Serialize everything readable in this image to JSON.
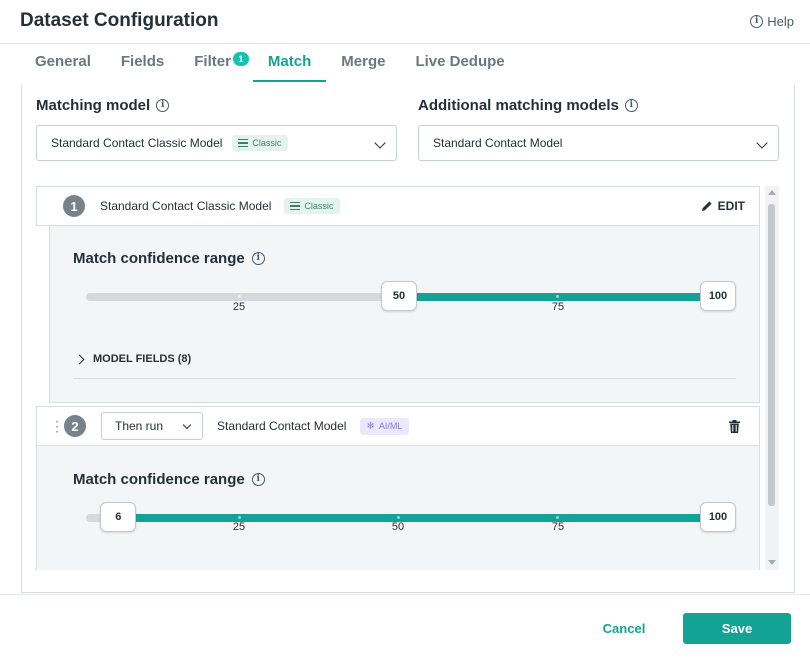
{
  "dialog": {
    "title": "Dataset Configuration",
    "help_label": "Help"
  },
  "tabs": [
    {
      "label": "General"
    },
    {
      "label": "Fields"
    },
    {
      "label": "Filter",
      "badge": "1"
    },
    {
      "label": "Match",
      "active": true
    },
    {
      "label": "Merge"
    },
    {
      "label": "Live Dedupe"
    }
  ],
  "matching_model": {
    "label": "Matching model",
    "value": "Standard Contact Classic Model",
    "badge": "Classic"
  },
  "additional_models": {
    "label": "Additional matching models",
    "value": "Standard Contact Model"
  },
  "cards": [
    {
      "step": "1",
      "model_name": "Standard Contact Classic Model",
      "badge": "Classic",
      "edit_label": "EDIT",
      "confidence_label": "Match confidence range",
      "range_min": 50,
      "range_max": 100,
      "ticks": [
        "25",
        "75"
      ],
      "model_fields_label": "MODEL FIELDS (8)"
    },
    {
      "step": "2",
      "then_run_label": "Then run",
      "model_name": "Standard Contact Model",
      "badge": "AI/ML",
      "confidence_label": "Match confidence range",
      "range_min": 6,
      "range_max": 100,
      "ticks": [
        "25",
        "50",
        "75"
      ]
    }
  ],
  "footer": {
    "cancel_label": "Cancel",
    "save_label": "Save"
  },
  "colors": {
    "accent": "#12a394",
    "badge_classic_bg": "#e4f3ee",
    "badge_aiml_bg": "#ece8fb"
  }
}
